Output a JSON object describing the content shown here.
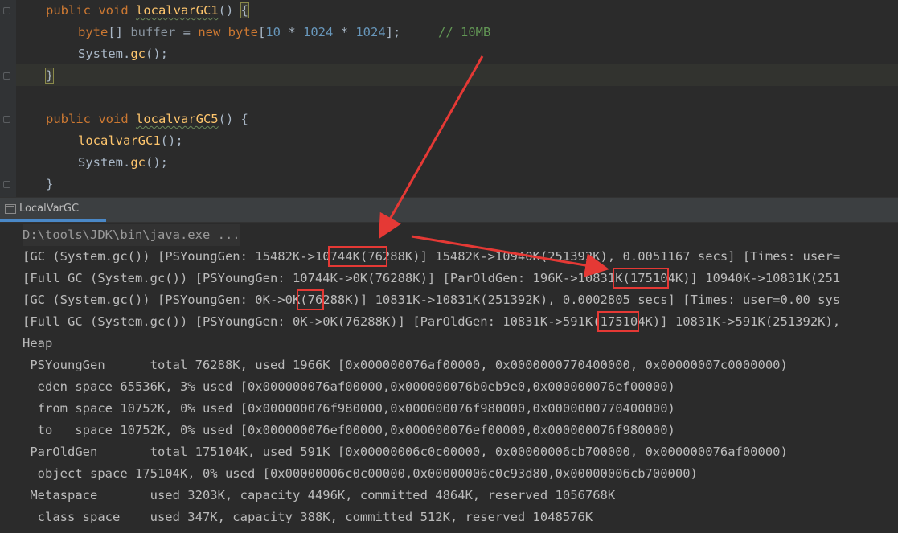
{
  "code": {
    "l1_kw": "public void ",
    "l1_fn": "localvarGC1",
    "l1_paren": "() ",
    "l1_brace": "{",
    "l2_type": "byte",
    "l2_a": "[] ",
    "l2_var": "buffer",
    "l2_b": " = ",
    "l2_new": "new ",
    "l2_type2": "byte",
    "l2_c": "[",
    "l2_n1": "10",
    "l2_d": " * ",
    "l2_n2": "1024",
    "l2_e": " * ",
    "l2_n3": "1024",
    "l2_f": "];",
    "l2_comment": "// 10MB",
    "l3_cls": "System.",
    "l3_gc": "gc",
    "l3_end": "();",
    "l4_brace": "}",
    "l6_kw": "public void ",
    "l6_fn": "localvarGC5",
    "l6_rest": "() {",
    "l7_fn": "localvarGC1",
    "l7_end": "();",
    "l8_cls": "System.",
    "l8_gc": "gc",
    "l8_end": "();",
    "l9_brace": "}"
  },
  "run_tab": {
    "label": "LocalVarGC"
  },
  "console": {
    "cmd": "D:\\tools\\JDK\\bin\\java.exe ...",
    "lines": [
      "[GC (System.gc()) [PSYoungGen: 15482K->10744K(76288K)] 15482K->10940K(251392K), 0.0051167 secs] [Times: user=",
      "[Full GC (System.gc()) [PSYoungGen: 10744K->0K(76288K)] [ParOldGen: 196K->10831K(175104K)] 10940K->10831K(251",
      "[GC (System.gc()) [PSYoungGen: 0K->0K(76288K)] 10831K->10831K(251392K), 0.0002805 secs] [Times: user=0.00 sys",
      "[Full GC (System.gc()) [PSYoungGen: 0K->0K(76288K)] [ParOldGen: 10831K->591K(175104K)] 10831K->591K(251392K),",
      "Heap",
      " PSYoungGen      total 76288K, used 1966K [0x000000076af00000, 0x0000000770400000, 0x00000007c0000000)",
      "  eden space 65536K, 3% used [0x000000076af00000,0x000000076b0eb9e0,0x000000076ef00000)",
      "  from space 10752K, 0% used [0x000000076f980000,0x000000076f980000,0x0000000770400000)",
      "  to   space 10752K, 0% used [0x000000076ef00000,0x000000076ef00000,0x000000076f980000)",
      " ParOldGen       total 175104K, used 591K [0x00000006c0c00000, 0x00000006cb700000, 0x000000076af00000)",
      "  object space 175104K, 0% used [0x00000006c0c00000,0x00000006c0c93d80,0x00000006cb700000)",
      " Metaspace       used 3203K, capacity 4496K, committed 4864K, reserved 1056768K",
      "  class space    used 347K, capacity 388K, committed 512K, reserved 1048576K"
    ]
  },
  "colors": {
    "annotation": "#e53935",
    "background": "#2b2b2b",
    "tab_underline": "#4a88c7"
  }
}
